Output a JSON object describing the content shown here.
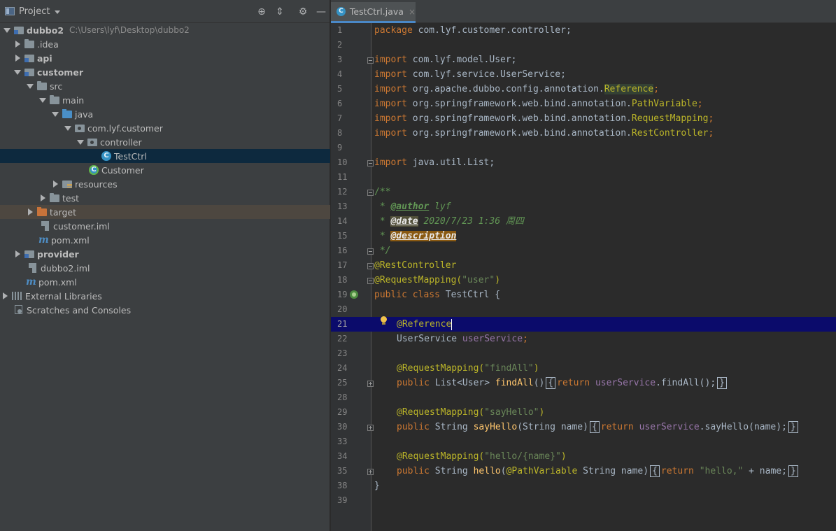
{
  "project_panel": {
    "title": "Project",
    "tree": [
      {
        "label": "dubbo2",
        "path": "C:\\Users\\lyf\\Desktop\\dubbo2",
        "bold": true
      },
      {
        "label": ".idea"
      },
      {
        "label": "api",
        "bold": true
      },
      {
        "label": "customer",
        "bold": true
      },
      {
        "label": "src"
      },
      {
        "label": "main"
      },
      {
        "label": "java"
      },
      {
        "label": "com.lyf.customer"
      },
      {
        "label": "controller"
      },
      {
        "label": "TestCtrl"
      },
      {
        "label": "Customer"
      },
      {
        "label": "resources"
      },
      {
        "label": "test"
      },
      {
        "label": "target"
      },
      {
        "label": "customer.iml"
      },
      {
        "label": "pom.xml"
      },
      {
        "label": "provider",
        "bold": true
      },
      {
        "label": "dubbo2.iml"
      },
      {
        "label": "pom.xml"
      },
      {
        "label": "External Libraries"
      },
      {
        "label": "Scratches and Consoles"
      }
    ]
  },
  "editor": {
    "tab_label": "TestCtrl.java",
    "tab_close": "×",
    "line_numbers": [
      "1",
      "2",
      "3",
      "4",
      "5",
      "6",
      "7",
      "8",
      "9",
      "10",
      "11",
      "12",
      "13",
      "14",
      "15",
      "16",
      "17",
      "18",
      "19",
      "20",
      "21",
      "22",
      "23",
      "24",
      "25",
      "28",
      "29",
      "30",
      "33",
      "34",
      "35",
      "38",
      "39"
    ],
    "current_line": "21",
    "code": {
      "l1_kw": "package",
      "l1_rest": " com.lyf.customer.controller;",
      "l3_kw": "import",
      "l3_rest": " com.lyf.model.User;",
      "l4_kw": "import",
      "l4_rest": " com.lyf.service.UserService;",
      "l5_kw": "import",
      "l5_rest": " org.apache.dubbo.config.annotation.",
      "l5_cls": "Reference",
      "l5_end": ";",
      "l6_kw": "import",
      "l6_rest": " org.springframework.web.bind.annotation.",
      "l6_cls": "PathVariable",
      "l6_end": ";",
      "l7_kw": "import",
      "l7_rest": " org.springframework.web.bind.annotation.",
      "l7_cls": "RequestMapping",
      "l7_end": ";",
      "l8_kw": "import",
      "l8_rest": " org.springframework.web.bind.annotation.",
      "l8_cls": "RestController",
      "l8_end": ";",
      "l10_kw": "import",
      "l10_rest": " java.util.List;",
      "l12": "/**",
      "l13_star": " * ",
      "l13_tag": "@author",
      "l13_val": " lyf",
      "l14_star": " * ",
      "l14_tag": "@date",
      "l14_val": " 2020/7/23 1:36 周四",
      "l15_star": " * ",
      "l15_tag": "@description",
      "l16": " */",
      "l17": "@RestController",
      "l18_ann": "@RequestMapping(",
      "l18_str": "\"user\"",
      "l18_end": ")",
      "l19_kw": "public class",
      "l19_rest": " TestCtrl {",
      "l21_ann": "@Reference",
      "l22_type": "UserService ",
      "l22_fld": "userService",
      "l22_end": ";",
      "l24_ann": "@RequestMapping(",
      "l24_str": "\"findAll\"",
      "l24_end": ")",
      "l25_kw": "public",
      "l25_type": " List<User> ",
      "l25_fn": "findAll",
      "l25_par": "()",
      "l25_open": "{",
      "l25_ret": "return",
      "l25_fld": "userService",
      "l25_call": ".findAll();",
      "l25_close": "}",
      "l29_ann": "@RequestMapping(",
      "l29_str": "\"sayHello\"",
      "l29_end": ")",
      "l30_kw": "public",
      "l30_type": " String ",
      "l30_fn": "sayHello",
      "l30_par": "(String name)",
      "l30_open": "{",
      "l30_ret": "return",
      "l30_fld": "userService",
      "l30_call": ".sayHello(name);",
      "l30_close": "}",
      "l34_ann": "@RequestMapping(",
      "l34_str": "\"hello/{name}\"",
      "l34_end": ")",
      "l35_kw": "public",
      "l35_type": " String ",
      "l35_fn": "hello",
      "l35_p1": "(",
      "l35_pann": "@PathVariable",
      "l35_p2": " String name)",
      "l35_open": "{",
      "l35_ret": "return",
      "l35_str": "\"hello,\"",
      "l35_rest": " + name;",
      "l35_close": "}",
      "l38": "}"
    }
  }
}
